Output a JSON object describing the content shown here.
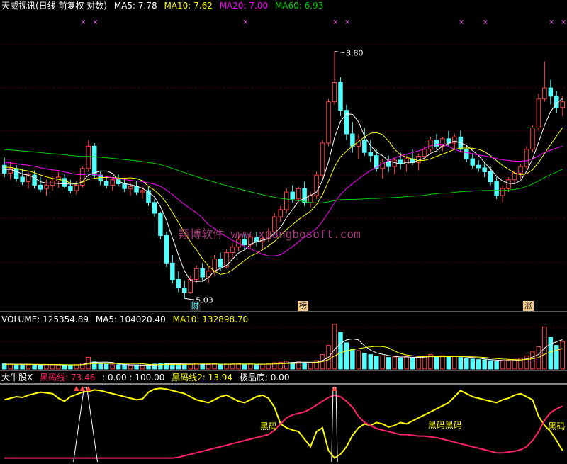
{
  "header": {
    "title": "天威视讯(日线 前复权 对数)",
    "ma5": "MA5: 7.78",
    "ma10": "MA10: 7.62",
    "ma20": "MA20: 7.00",
    "ma60": "MA60: 6.93"
  },
  "volume_header": {
    "volume": "VOLUME: 125354.89",
    "ma5": "MA5: 104020.40",
    "ma10": "MA10: 132898.70"
  },
  "indicator_header": {
    "name": "大牛股X",
    "line1": "黑码线: 73.46",
    "range": ": 0.00 : 100.00",
    "line2": "黑码线2: 13.94",
    "bottom": "极品底: 0.00"
  },
  "watermark": "翔博软件 www.xiangbosoft.com",
  "annotations": {
    "high_label": "8.80",
    "low_label": "5.03",
    "tags": [
      "财",
      "榜",
      "涨"
    ],
    "indicator_labels": [
      "黑码",
      "黑码黑码",
      "黑码"
    ]
  },
  "colors": {
    "up": "#ff4444",
    "down": "#54ffff",
    "ma5": "#ffffff",
    "ma10": "#ffff00",
    "ma20": "#ff00ff",
    "ma60": "#00cc00",
    "vol_ma10": "#ffff00",
    "ind_yellow": "#ffff00",
    "ind_red": "#ff2266",
    "marker": "#ff66ff"
  },
  "chart_data": [
    {
      "type": "candlestick",
      "scale": "log",
      "ylim": [
        5.0,
        9.3
      ],
      "marked_high": 8.8,
      "marked_low": 5.03,
      "ohlc": [
        [
          6.8,
          6.92,
          6.62,
          6.68
        ],
        [
          6.68,
          6.85,
          6.58,
          6.75
        ],
        [
          6.75,
          6.8,
          6.55,
          6.6
        ],
        [
          6.62,
          6.74,
          6.5,
          6.55
        ],
        [
          6.55,
          6.7,
          6.45,
          6.66
        ],
        [
          6.65,
          6.72,
          6.45,
          6.5
        ],
        [
          6.5,
          6.62,
          6.4,
          6.44
        ],
        [
          6.45,
          6.58,
          6.35,
          6.5
        ],
        [
          6.5,
          6.64,
          6.42,
          6.56
        ],
        [
          6.56,
          6.7,
          6.46,
          6.62
        ],
        [
          6.6,
          6.66,
          6.45,
          6.48
        ],
        [
          6.48,
          6.58,
          6.38,
          6.42
        ],
        [
          6.42,
          6.56,
          6.36,
          6.5
        ],
        [
          6.5,
          6.78,
          6.46,
          6.75
        ],
        [
          6.75,
          7.2,
          6.7,
          7.1
        ],
        [
          7.1,
          7.15,
          6.6,
          6.65
        ],
        [
          6.65,
          6.72,
          6.5,
          6.56
        ],
        [
          6.56,
          6.64,
          6.45,
          6.5
        ],
        [
          6.5,
          6.62,
          6.42,
          6.58
        ],
        [
          6.58,
          6.66,
          6.48,
          6.52
        ],
        [
          6.52,
          6.6,
          6.4,
          6.45
        ],
        [
          6.45,
          6.54,
          6.35,
          6.48
        ],
        [
          6.48,
          6.56,
          6.36,
          6.4
        ],
        [
          6.4,
          6.5,
          6.3,
          6.42
        ],
        [
          6.42,
          6.48,
          6.2,
          6.25
        ],
        [
          6.25,
          6.3,
          6.05,
          6.1
        ],
        [
          6.1,
          6.12,
          5.75,
          5.8
        ],
        [
          5.8,
          5.85,
          5.4,
          5.45
        ],
        [
          5.45,
          5.55,
          5.2,
          5.25
        ],
        [
          5.25,
          5.35,
          5.1,
          5.15
        ],
        [
          5.15,
          5.24,
          5.03,
          5.1
        ],
        [
          5.1,
          5.3,
          5.08,
          5.25
        ],
        [
          5.25,
          5.42,
          5.2,
          5.38
        ],
        [
          5.38,
          5.45,
          5.22,
          5.28
        ],
        [
          5.28,
          5.4,
          5.2,
          5.35
        ],
        [
          5.35,
          5.55,
          5.3,
          5.5
        ],
        [
          5.5,
          5.58,
          5.35,
          5.4
        ],
        [
          5.4,
          5.62,
          5.38,
          5.58
        ],
        [
          5.58,
          5.7,
          5.5,
          5.65
        ],
        [
          5.65,
          5.8,
          5.6,
          5.75
        ],
        [
          5.75,
          5.82,
          5.62,
          5.68
        ],
        [
          5.68,
          5.8,
          5.64,
          5.78
        ],
        [
          5.78,
          5.85,
          5.66,
          5.72
        ],
        [
          5.72,
          5.8,
          5.62,
          5.76
        ],
        [
          5.76,
          5.9,
          5.72,
          5.85
        ],
        [
          5.85,
          6.1,
          5.82,
          6.05
        ],
        [
          6.05,
          6.2,
          5.98,
          6.15
        ],
        [
          6.15,
          6.45,
          6.1,
          6.4
        ],
        [
          6.4,
          6.5,
          6.25,
          6.3
        ],
        [
          6.3,
          6.48,
          6.26,
          6.45
        ],
        [
          6.45,
          6.55,
          6.2,
          6.25
        ],
        [
          6.25,
          6.4,
          6.18,
          6.35
        ],
        [
          6.35,
          6.7,
          6.3,
          6.65
        ],
        [
          6.65,
          7.2,
          6.6,
          7.15
        ],
        [
          7.15,
          7.9,
          7.1,
          7.85
        ],
        [
          7.85,
          8.8,
          7.8,
          8.2
        ],
        [
          8.2,
          8.3,
          7.6,
          7.7
        ],
        [
          7.7,
          7.8,
          7.2,
          7.3
        ],
        [
          7.3,
          7.5,
          7.0,
          7.1
        ],
        [
          7.1,
          7.3,
          6.9,
          7.2
        ],
        [
          7.2,
          7.4,
          6.95,
          7.0
        ],
        [
          7.0,
          7.2,
          6.85,
          6.95
        ],
        [
          6.95,
          7.05,
          6.7,
          6.75
        ],
        [
          6.75,
          6.9,
          6.6,
          6.85
        ],
        [
          6.85,
          6.95,
          6.7,
          6.78
        ],
        [
          6.78,
          6.92,
          6.66,
          6.88
        ],
        [
          6.88,
          7.0,
          6.74,
          6.82
        ],
        [
          6.82,
          6.95,
          6.7,
          6.9
        ],
        [
          6.9,
          7.05,
          6.8,
          6.84
        ],
        [
          6.84,
          6.98,
          6.72,
          6.94
        ],
        [
          6.94,
          7.1,
          6.88,
          7.05
        ],
        [
          7.05,
          7.25,
          7.0,
          7.2
        ],
        [
          7.2,
          7.3,
          7.05,
          7.1
        ],
        [
          7.1,
          7.25,
          7.02,
          7.22
        ],
        [
          7.22,
          7.35,
          7.1,
          7.15
        ],
        [
          7.15,
          7.3,
          7.05,
          7.25
        ],
        [
          7.25,
          7.35,
          7.0,
          7.05
        ],
        [
          7.05,
          7.12,
          6.85,
          6.9
        ],
        [
          6.9,
          6.98,
          6.75,
          6.8
        ],
        [
          6.8,
          6.88,
          6.7,
          6.76
        ],
        [
          6.76,
          6.85,
          6.62,
          6.7
        ],
        [
          6.7,
          6.78,
          6.5,
          6.55
        ],
        [
          6.55,
          6.62,
          6.3,
          6.35
        ],
        [
          6.35,
          6.5,
          6.25,
          6.45
        ],
        [
          6.45,
          6.62,
          6.4,
          6.58
        ],
        [
          6.58,
          6.72,
          6.52,
          6.68
        ],
        [
          6.68,
          6.82,
          6.6,
          6.78
        ],
        [
          6.78,
          7.1,
          6.74,
          7.05
        ],
        [
          7.05,
          7.45,
          7.0,
          7.4
        ],
        [
          7.4,
          8.0,
          7.35,
          7.9
        ],
        [
          7.9,
          8.6,
          7.85,
          8.1
        ],
        [
          8.1,
          8.25,
          7.8,
          7.95
        ],
        [
          7.95,
          8.05,
          7.65,
          7.75
        ],
        [
          7.75,
          7.95,
          7.6,
          7.85
        ]
      ],
      "ma5_last": 7.78,
      "ma10_last": 7.62,
      "ma20_last": 7.0,
      "ma60_last": 6.93
    },
    {
      "type": "bar",
      "title": "VOLUME",
      "values": [
        40,
        38,
        35,
        36,
        33,
        34,
        32,
        35,
        33,
        31,
        30,
        32,
        34,
        45,
        90,
        55,
        40,
        36,
        34,
        33,
        32,
        30,
        31,
        29,
        35,
        38,
        42,
        45,
        40,
        36,
        34,
        38,
        42,
        36,
        35,
        40,
        34,
        38,
        40,
        42,
        36,
        38,
        34,
        37,
        40,
        48,
        52,
        60,
        50,
        55,
        48,
        46,
        65,
        110,
        180,
        340,
        280,
        200,
        150,
        140,
        120,
        110,
        95,
        100,
        88,
        92,
        85,
        96,
        84,
        90,
        98,
        110,
        95,
        102,
        90,
        100,
        88,
        80,
        76,
        72,
        70,
        64,
        58,
        62,
        68,
        74,
        82,
        100,
        130,
        170,
        320,
        240,
        180,
        210
      ],
      "vol_last": 125354.89,
      "ma5_last": 104020.4,
      "ma10_last": 132898.7
    },
    {
      "type": "line",
      "title": "大牛股X",
      "ylim": [
        0,
        100
      ],
      "series": [
        {
          "name": "黑码线",
          "last": 73.46
        },
        {
          "name": "黑码线2",
          "last": 13.94
        }
      ],
      "yellow": [
        82,
        84,
        86,
        85,
        88,
        90,
        92,
        91,
        90,
        84,
        80,
        86,
        89,
        92,
        93,
        95,
        94,
        92,
        90,
        88,
        86,
        84,
        82,
        83,
        92,
        96,
        97,
        96,
        94,
        92,
        90,
        86,
        82,
        80,
        78,
        82,
        86,
        88,
        84,
        80,
        78,
        82,
        86,
        88,
        84,
        72,
        50,
        45,
        42,
        40,
        30,
        20,
        40,
        45,
        15,
        5,
        10,
        20,
        35,
        45,
        50,
        48,
        52,
        50,
        46,
        48,
        52,
        50,
        54,
        58,
        62,
        66,
        70,
        74,
        78,
        86,
        94,
        90,
        86,
        84,
        82,
        80,
        78,
        82,
        84,
        88,
        90,
        86,
        82,
        60,
        48,
        40,
        28,
        15
      ],
      "red": [
        5,
        5,
        5,
        5,
        5,
        5,
        5,
        5,
        5,
        5,
        5,
        5,
        5,
        5,
        5,
        5,
        5,
        5,
        5,
        5,
        5,
        5,
        5,
        5,
        5,
        5,
        5,
        5,
        5,
        6,
        8,
        10,
        12,
        14,
        16,
        18,
        20,
        22,
        24,
        26,
        28,
        30,
        32,
        34,
        36,
        42,
        50,
        58,
        62,
        64,
        66,
        70,
        75,
        80,
        85,
        88,
        86,
        80,
        72,
        60,
        52,
        48,
        44,
        42,
        40,
        38,
        36,
        36,
        35,
        34,
        34,
        33,
        32,
        30,
        28,
        26,
        24,
        22,
        20,
        18,
        16,
        14,
        12,
        12,
        13,
        14,
        16,
        20,
        28,
        40,
        55,
        65,
        70,
        73.46
      ],
      "arrows_at": [
        12,
        13,
        14,
        55
      ]
    }
  ]
}
